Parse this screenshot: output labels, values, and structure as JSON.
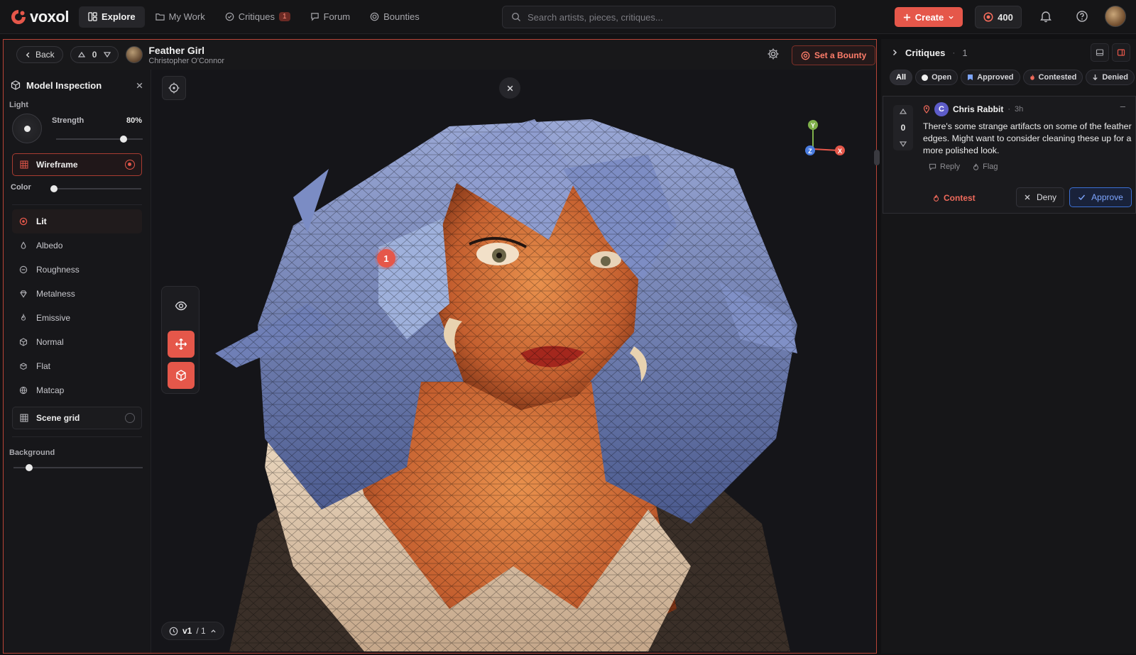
{
  "app": {
    "logo_text": "voxol",
    "nav": [
      {
        "label": "Explore",
        "icon": "grid-icon"
      },
      {
        "label": "My Work",
        "icon": "folder-icon"
      },
      {
        "label": "Critiques",
        "icon": "check-circle-icon",
        "badge": "1"
      },
      {
        "label": "Forum",
        "icon": "chat-icon"
      },
      {
        "label": "Bounties",
        "icon": "target-icon"
      }
    ],
    "search_placeholder": "Search artists, pieces, critiques...",
    "create_label": "Create",
    "coins": "400",
    "accent": "#e5574a"
  },
  "viewer": {
    "back_label": "Back",
    "votes": "0",
    "title": "Feather Girl",
    "author": "Christopher O'Connor",
    "bounty_label": "Set a Bounty",
    "version": "v1",
    "version_total": "/ 1",
    "marker_number": "1",
    "gizmo": {
      "y": "Y",
      "z": "Z",
      "x": "X"
    }
  },
  "inspector": {
    "title": "Model Inspection",
    "light_label": "Light",
    "strength_label": "Strength",
    "strength_value": "80%",
    "strength_level": 0.8,
    "wireframe_label": "Wireframe",
    "wireframe_on": true,
    "color_label": "Color",
    "modes": [
      {
        "label": "Lit",
        "icon": "lit-icon",
        "active": true
      },
      {
        "label": "Albedo",
        "icon": "drop-icon",
        "active": false
      },
      {
        "label": "Roughness",
        "icon": "roughness-icon",
        "active": false
      },
      {
        "label": "Metalness",
        "icon": "gem-icon",
        "active": false
      },
      {
        "label": "Emissive",
        "icon": "flame-icon",
        "active": false
      },
      {
        "label": "Normal",
        "icon": "cube-icon",
        "active": false
      },
      {
        "label": "Flat",
        "icon": "box-icon",
        "active": false
      },
      {
        "label": "Matcap",
        "icon": "globe-icon",
        "active": false
      }
    ],
    "scene_grid_label": "Scene grid",
    "scene_grid_on": false,
    "background_label": "Background",
    "background_level": 0.1
  },
  "critiques": {
    "title": "Critiques",
    "count": "1",
    "filters": [
      {
        "label": "All",
        "active": true
      },
      {
        "label": "Open",
        "active": false
      },
      {
        "label": "Approved",
        "active": false
      },
      {
        "label": "Contested",
        "active": false
      },
      {
        "label": "Denied",
        "active": false
      }
    ],
    "items": [
      {
        "votes": "0",
        "avatar_letter": "C",
        "author": "Chris Rabbit",
        "time": "3h",
        "more": "–",
        "body": "There's some strange artifacts on some of the feather edges. Might want to consider cleaning these up for a more polished look.",
        "reply_label": "Reply",
        "flag_label": "Flag",
        "contest_label": "Contest",
        "deny_label": "Deny",
        "approve_label": "Approve"
      }
    ]
  }
}
